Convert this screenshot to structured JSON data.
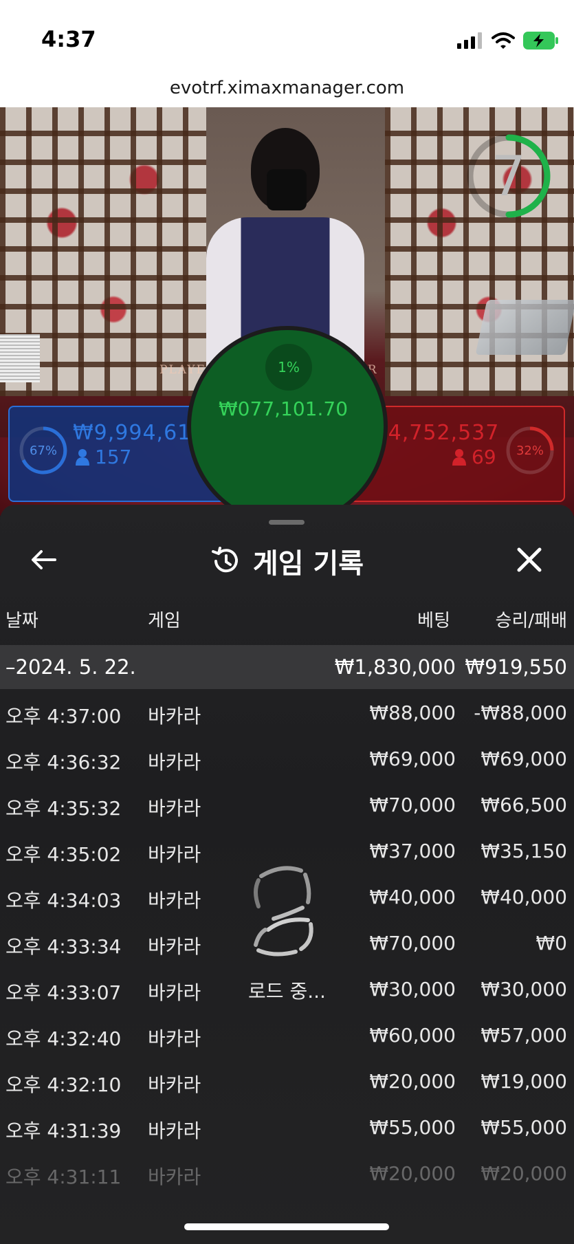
{
  "status": {
    "time": "4:37"
  },
  "browser": {
    "url": "evotrf.ximaxmanager.com"
  },
  "stream": {
    "timer": "7",
    "table_left": "PLAYER",
    "table_right": "BANKER",
    "player": {
      "percent": "67%",
      "amount": "₩9,994,611",
      "count": "157"
    },
    "banker": {
      "percent": "32%",
      "amount": "₩4,752,537",
      "count": "69"
    },
    "tie": {
      "percent": "1%",
      "amount": "₩077,101.70"
    }
  },
  "sheet": {
    "title": "게임 기록",
    "columns": {
      "date": "날짜",
      "game": "게임",
      "bet": "베팅",
      "result": "승리/패배"
    },
    "date_group": {
      "label": "–2024. 5. 22.",
      "bet": "₩1,830,000",
      "result": "₩919,550"
    },
    "rows": [
      {
        "time": "오후 4:37:00",
        "game": "바카라",
        "bet": "₩88,000",
        "result": "-₩88,000"
      },
      {
        "time": "오후 4:36:32",
        "game": "바카라",
        "bet": "₩69,000",
        "result": "₩69,000"
      },
      {
        "time": "오후 4:35:32",
        "game": "바카라",
        "bet": "₩70,000",
        "result": "₩66,500"
      },
      {
        "time": "오후 4:35:02",
        "game": "바카라",
        "bet": "₩37,000",
        "result": "₩35,150"
      },
      {
        "time": "오후 4:34:03",
        "game": "바카라",
        "bet": "₩40,000",
        "result": "₩40,000"
      },
      {
        "time": "오후 4:33:34",
        "game": "바카라",
        "bet": "₩70,000",
        "result": "₩0"
      },
      {
        "time": "오후 4:33:07",
        "game": "바카라",
        "bet": "₩30,000",
        "result": "₩30,000"
      },
      {
        "time": "오후 4:32:40",
        "game": "바카라",
        "bet": "₩60,000",
        "result": "₩57,000"
      },
      {
        "time": "오후 4:32:10",
        "game": "바카라",
        "bet": "₩20,000",
        "result": "₩19,000"
      },
      {
        "time": "오후 4:31:39",
        "game": "바카라",
        "bet": "₩55,000",
        "result": "₩55,000"
      },
      {
        "time": "오후 4:31:11",
        "game": "바카라",
        "bet": "₩20,000",
        "result": "₩20,000"
      }
    ],
    "loading_text": "로드 중..."
  },
  "colors": {
    "player": "#2a6fd8",
    "banker": "#d02a2a",
    "tie": "#35d35a",
    "timer": "#1fb24a"
  },
  "icons": [
    "signal-icon",
    "wifi-icon",
    "battery-icon",
    "back-arrow-icon",
    "history-icon",
    "close-icon",
    "loading-spinner-icon",
    "person-icon"
  ]
}
